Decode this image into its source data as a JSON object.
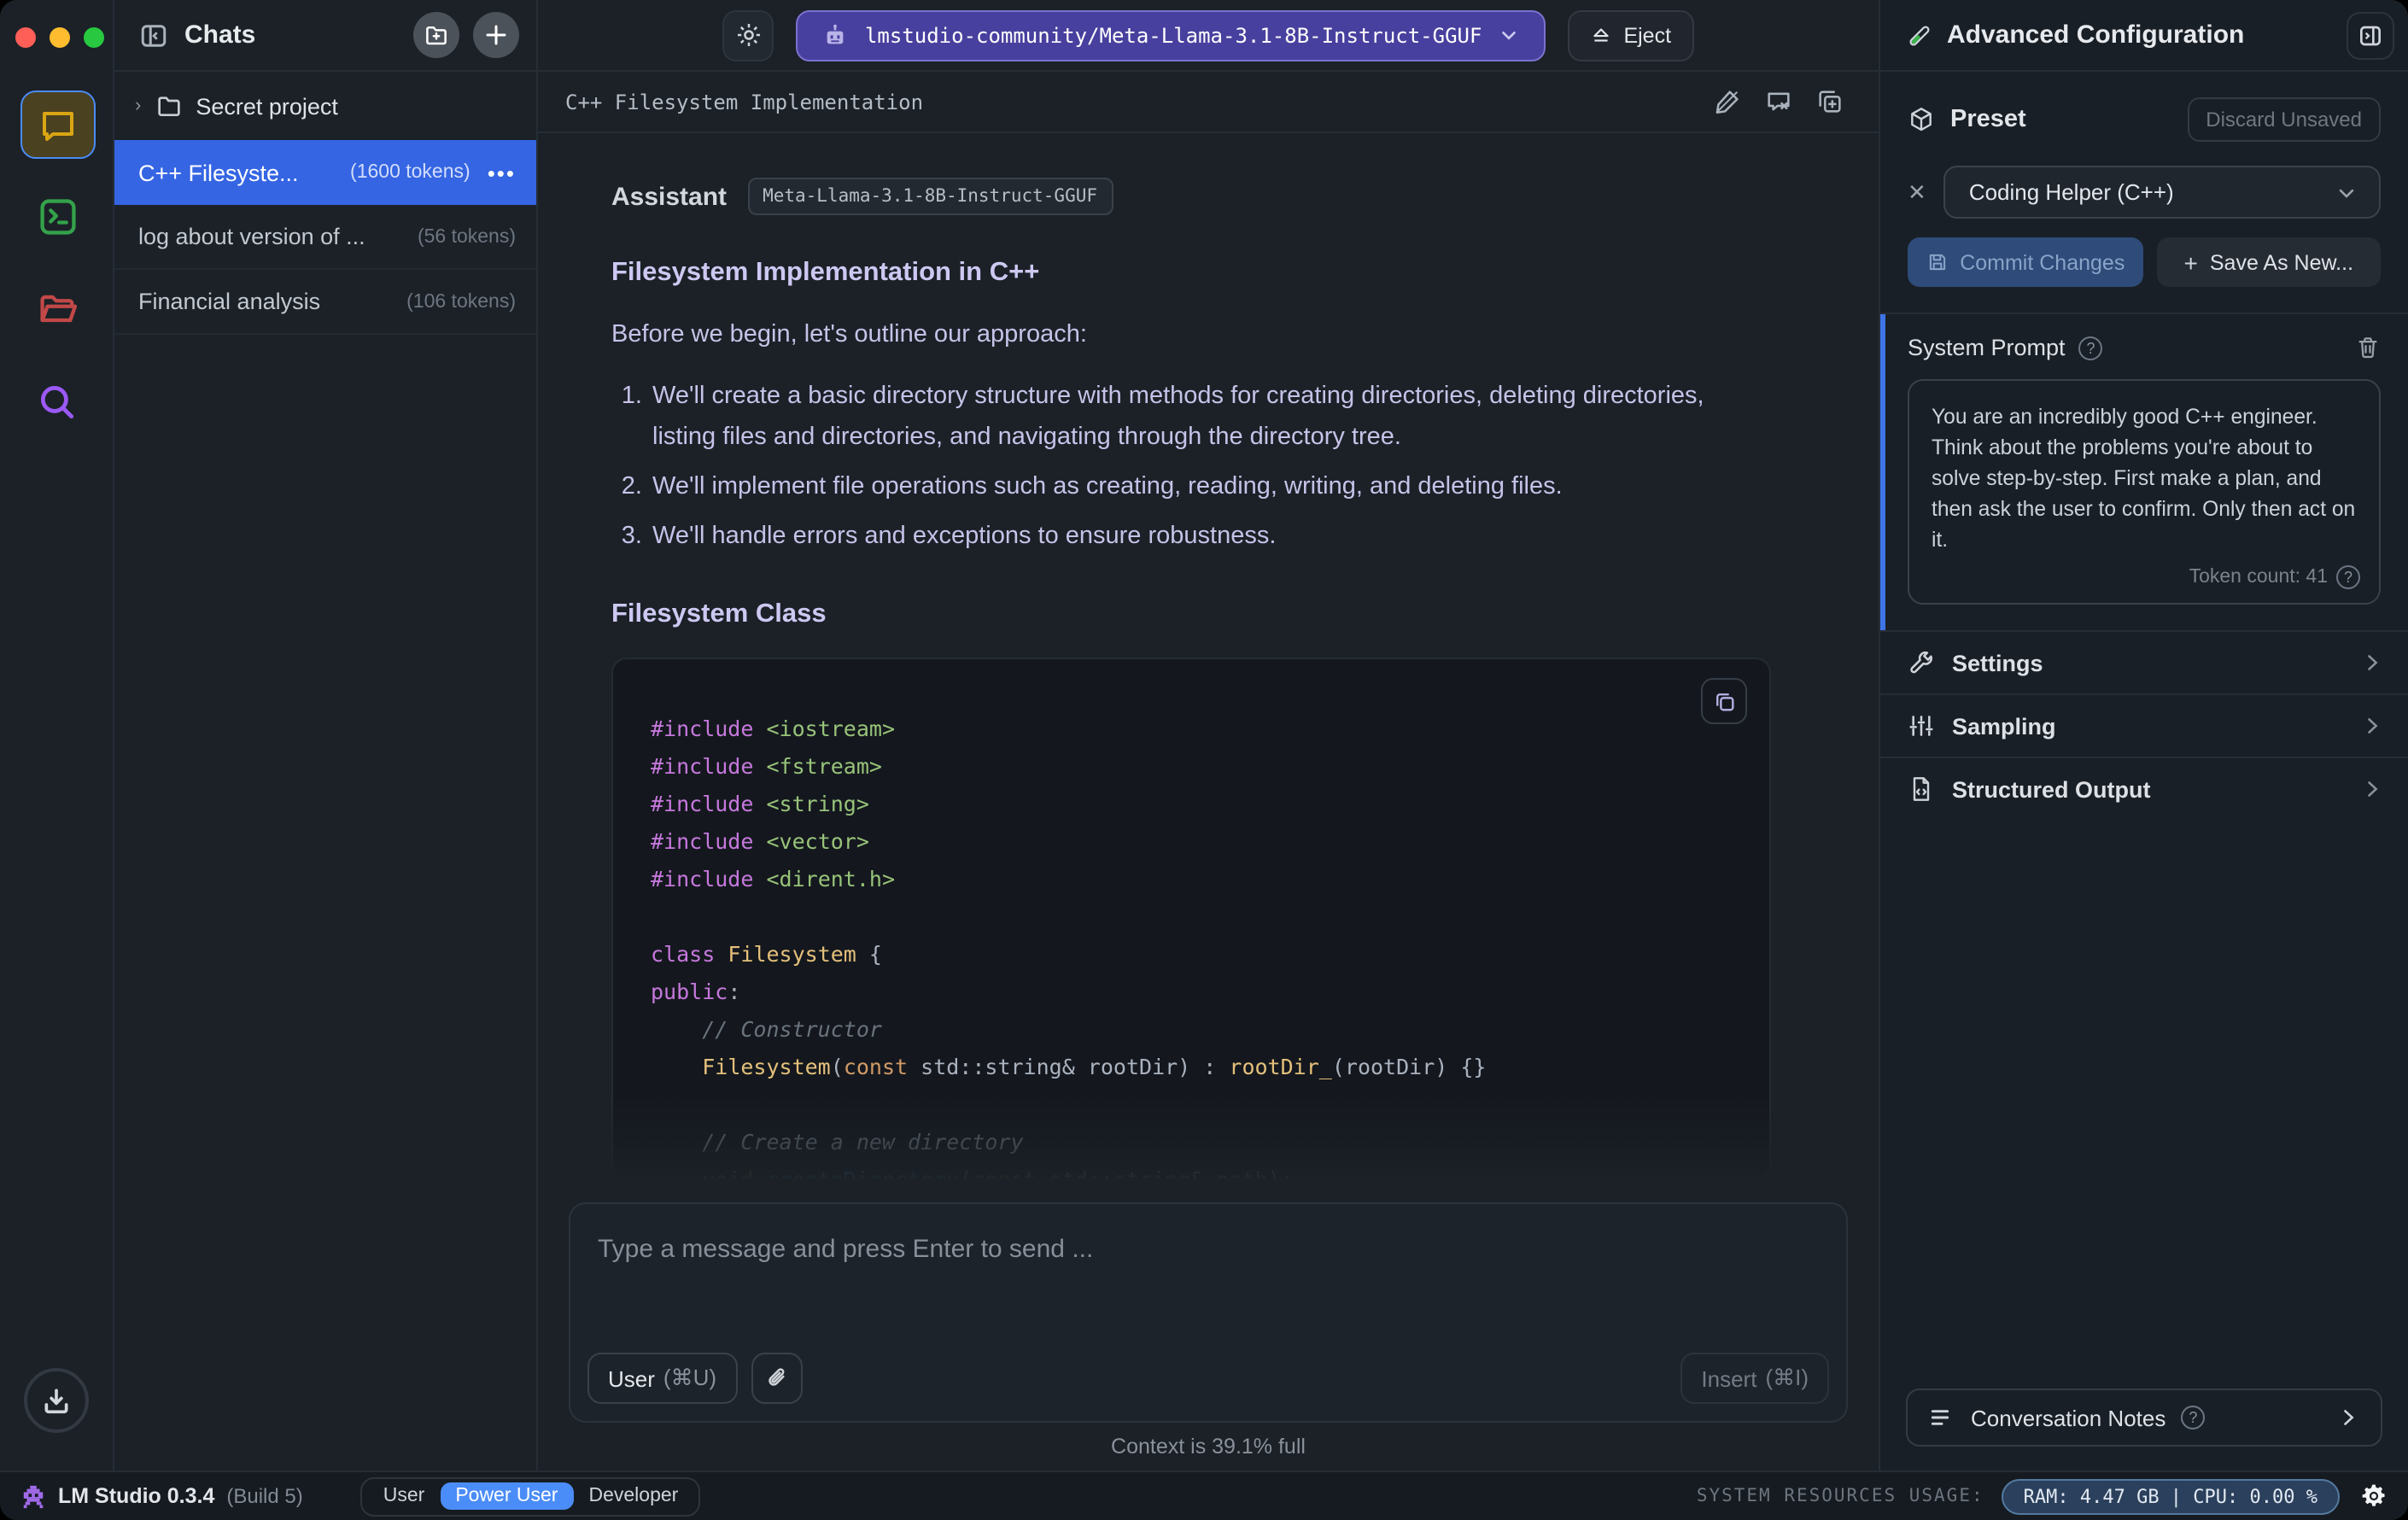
{
  "rail": {
    "icons": [
      "chat-icon",
      "terminal-icon",
      "folder-icon",
      "search-icon",
      "download-icon"
    ]
  },
  "chats_panel": {
    "title": "Chats",
    "folder_row": {
      "twisty": "›",
      "name": "Secret project"
    },
    "items": [
      {
        "title": "C++ Filesyste...",
        "tokens": "(1600 tokens)",
        "selected": true,
        "dots": "•••"
      },
      {
        "title": "log about version of ...",
        "tokens": "(56 tokens)",
        "selected": false
      },
      {
        "title": "Financial analysis",
        "tokens": "(106 tokens)",
        "selected": false
      }
    ]
  },
  "topbar": {
    "model_name": "lmstudio-community/Meta-Llama-3.1-8B-Instruct-GGUF",
    "eject_label": "Eject"
  },
  "chat_tab": {
    "title": "C++ Filesystem Implementation"
  },
  "message": {
    "role": "Assistant",
    "model_badge": "Meta-Llama-3.1-8B-Instruct-GGUF",
    "heading1": "Filesystem Implementation in C++",
    "intro": "Before we begin, let's outline our approach:",
    "list": [
      "We'll create a basic directory structure with methods for creating directories, deleting directories, listing files and directories, and navigating through the directory tree.",
      "We'll implement file operations such as creating, reading, writing, and deleting files.",
      "We'll handle errors and exceptions to ensure robustness."
    ],
    "heading2": "Filesystem Class"
  },
  "code": {
    "lines": [
      {
        "tokens": [
          {
            "t": "#include",
            "c": "kw"
          },
          {
            "t": " ",
            "c": "pln"
          },
          {
            "t": "<iostream>",
            "c": "str"
          }
        ]
      },
      {
        "tokens": [
          {
            "t": "#include",
            "c": "kw"
          },
          {
            "t": " ",
            "c": "pln"
          },
          {
            "t": "<fstream>",
            "c": "str"
          }
        ]
      },
      {
        "tokens": [
          {
            "t": "#include",
            "c": "kw"
          },
          {
            "t": " ",
            "c": "pln"
          },
          {
            "t": "<string>",
            "c": "str"
          }
        ]
      },
      {
        "tokens": [
          {
            "t": "#include",
            "c": "kw"
          },
          {
            "t": " ",
            "c": "pln"
          },
          {
            "t": "<vector>",
            "c": "str"
          }
        ]
      },
      {
        "tokens": [
          {
            "t": "#include",
            "c": "kw"
          },
          {
            "t": " ",
            "c": "pln"
          },
          {
            "t": "<dirent.h>",
            "c": "str"
          }
        ]
      },
      {
        "tokens": [
          {
            "t": " ",
            "c": "pln"
          }
        ]
      },
      {
        "tokens": [
          {
            "t": "class",
            "c": "kw"
          },
          {
            "t": " ",
            "c": "pln"
          },
          {
            "t": "Filesystem",
            "c": "typ"
          },
          {
            "t": " {",
            "c": "pln"
          }
        ]
      },
      {
        "tokens": [
          {
            "t": "public",
            "c": "kw"
          },
          {
            "t": ":",
            "c": "pln"
          }
        ]
      },
      {
        "tokens": [
          {
            "t": "    ",
            "c": "pln"
          },
          {
            "t": "// Constructor",
            "c": "com"
          }
        ]
      },
      {
        "tokens": [
          {
            "t": "    ",
            "c": "pln"
          },
          {
            "t": "Filesystem",
            "c": "typ"
          },
          {
            "t": "(",
            "c": "pln"
          },
          {
            "t": "const",
            "c": "orn"
          },
          {
            "t": " std::string& rootDir) : ",
            "c": "pln"
          },
          {
            "t": "rootDir_",
            "c": "typ"
          },
          {
            "t": "(rootDir) {}",
            "c": "pln"
          }
        ]
      },
      {
        "tokens": [
          {
            "t": " ",
            "c": "pln"
          }
        ]
      },
      {
        "tokens": [
          {
            "t": "    ",
            "c": "pln"
          },
          {
            "t": "// Create a new directory",
            "c": "com"
          }
        ]
      },
      {
        "dim": true,
        "tokens": [
          {
            "t": "    ",
            "c": "pln"
          },
          {
            "t": "void",
            "c": "orn"
          },
          {
            "t": " ",
            "c": "pln"
          },
          {
            "t": "createDirectory",
            "c": "fn"
          },
          {
            "t": "(",
            "c": "pln"
          },
          {
            "t": "const",
            "c": "orn"
          },
          {
            "t": " std::string& path);",
            "c": "pln"
          }
        ]
      }
    ]
  },
  "composer": {
    "placeholder": "Type a message and press Enter to send ...",
    "role_button": "User",
    "role_shortcut": "(⌘U)",
    "insert_label": "Insert",
    "insert_shortcut": "(⌘I)",
    "context_status": "Context is 39.1% full"
  },
  "config_panel": {
    "title": "Advanced Configuration",
    "preset": {
      "label": "Preset",
      "discard_label": "Discard Unsaved",
      "value": "Coding Helper (C++)",
      "commit_label": "Commit Changes",
      "save_new_plus": "+",
      "save_new_label": "Save As New...",
      "close_glyph": "✕"
    },
    "system_prompt": {
      "label": "System Prompt",
      "text": "You are an incredibly good C++ engineer. Think about the problems you're about to solve step-by-step. First make a plan, and then ask the user to confirm. Only then act on it.",
      "token_count": "Token count: 41",
      "help_glyph": "?"
    },
    "sections": [
      {
        "label": "Settings",
        "icon": "wrench-icon"
      },
      {
        "label": "Sampling",
        "icon": "sliders-icon"
      },
      {
        "label": "Structured Output",
        "icon": "file-json-icon"
      }
    ],
    "notes": {
      "label": "Conversation Notes"
    }
  },
  "statusbar": {
    "app_name": "LM Studio 0.3.4",
    "build": "(Build 5)",
    "modes": [
      "User",
      "Power User",
      "Developer"
    ],
    "active_mode": "Power User",
    "resources_label": "SYSTEM RESOURCES USAGE:",
    "ram_cpu": "RAM: 4.47 GB  |  CPU: 0.00 %"
  },
  "colors": {
    "selected_chat": "#3565e3",
    "model_pill": "#48409e",
    "accent_blue": "#3d74e8",
    "mode_active": "#4b8df8",
    "rail_chat": "#d9a514",
    "rail_terminal": "#34a24a",
    "rail_folder": "#c14848",
    "rail_search": "#9b59f5"
  }
}
